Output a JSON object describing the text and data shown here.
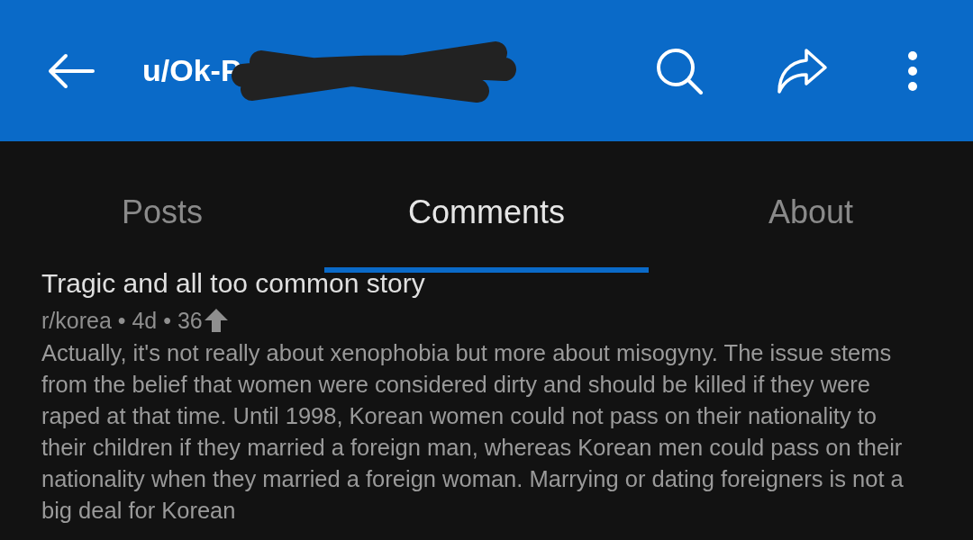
{
  "header": {
    "title": "u/Ok-P"
  },
  "tabs": [
    {
      "label": "Posts",
      "selected": false
    },
    {
      "label": "Comments",
      "selected": true
    },
    {
      "label": "About",
      "selected": false
    }
  ],
  "comment": {
    "title": "Tragic and all too common story",
    "meta": "r/korea • 4d • 36",
    "body": "Actually, it's not really about xenophobia but more about misogyny. The issue stems from the belief that women were considered dirty and should be killed if they were raped at that time. Until 1998, Korean women could not pass on their nationality to their children if they married a foreign man, whereas Korean men could pass on their nationality when they married a foreign woman. Marrying or dating foreigners is not a big deal for Korean"
  }
}
